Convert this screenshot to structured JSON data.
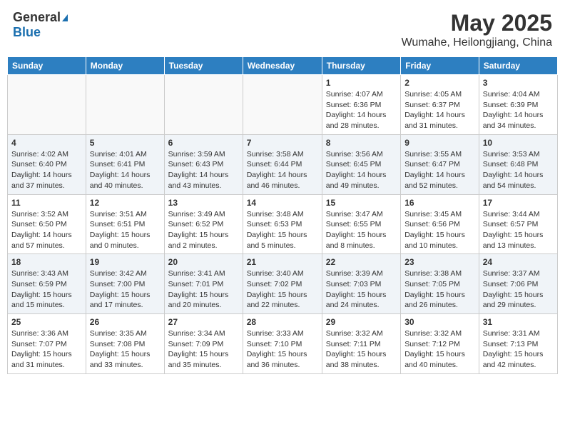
{
  "header": {
    "logo_general": "General",
    "logo_blue": "Blue",
    "title": "May 2025",
    "location": "Wumahe, Heilongjiang, China"
  },
  "days_of_week": [
    "Sunday",
    "Monday",
    "Tuesday",
    "Wednesday",
    "Thursday",
    "Friday",
    "Saturday"
  ],
  "weeks": [
    {
      "shaded": false,
      "days": [
        {
          "num": "",
          "info": ""
        },
        {
          "num": "",
          "info": ""
        },
        {
          "num": "",
          "info": ""
        },
        {
          "num": "",
          "info": ""
        },
        {
          "num": "1",
          "info": "Sunrise: 4:07 AM\nSunset: 6:36 PM\nDaylight: 14 hours\nand 28 minutes."
        },
        {
          "num": "2",
          "info": "Sunrise: 4:05 AM\nSunset: 6:37 PM\nDaylight: 14 hours\nand 31 minutes."
        },
        {
          "num": "3",
          "info": "Sunrise: 4:04 AM\nSunset: 6:39 PM\nDaylight: 14 hours\nand 34 minutes."
        }
      ]
    },
    {
      "shaded": true,
      "days": [
        {
          "num": "4",
          "info": "Sunrise: 4:02 AM\nSunset: 6:40 PM\nDaylight: 14 hours\nand 37 minutes."
        },
        {
          "num": "5",
          "info": "Sunrise: 4:01 AM\nSunset: 6:41 PM\nDaylight: 14 hours\nand 40 minutes."
        },
        {
          "num": "6",
          "info": "Sunrise: 3:59 AM\nSunset: 6:43 PM\nDaylight: 14 hours\nand 43 minutes."
        },
        {
          "num": "7",
          "info": "Sunrise: 3:58 AM\nSunset: 6:44 PM\nDaylight: 14 hours\nand 46 minutes."
        },
        {
          "num": "8",
          "info": "Sunrise: 3:56 AM\nSunset: 6:45 PM\nDaylight: 14 hours\nand 49 minutes."
        },
        {
          "num": "9",
          "info": "Sunrise: 3:55 AM\nSunset: 6:47 PM\nDaylight: 14 hours\nand 52 minutes."
        },
        {
          "num": "10",
          "info": "Sunrise: 3:53 AM\nSunset: 6:48 PM\nDaylight: 14 hours\nand 54 minutes."
        }
      ]
    },
    {
      "shaded": false,
      "days": [
        {
          "num": "11",
          "info": "Sunrise: 3:52 AM\nSunset: 6:50 PM\nDaylight: 14 hours\nand 57 minutes."
        },
        {
          "num": "12",
          "info": "Sunrise: 3:51 AM\nSunset: 6:51 PM\nDaylight: 15 hours\nand 0 minutes."
        },
        {
          "num": "13",
          "info": "Sunrise: 3:49 AM\nSunset: 6:52 PM\nDaylight: 15 hours\nand 2 minutes."
        },
        {
          "num": "14",
          "info": "Sunrise: 3:48 AM\nSunset: 6:53 PM\nDaylight: 15 hours\nand 5 minutes."
        },
        {
          "num": "15",
          "info": "Sunrise: 3:47 AM\nSunset: 6:55 PM\nDaylight: 15 hours\nand 8 minutes."
        },
        {
          "num": "16",
          "info": "Sunrise: 3:45 AM\nSunset: 6:56 PM\nDaylight: 15 hours\nand 10 minutes."
        },
        {
          "num": "17",
          "info": "Sunrise: 3:44 AM\nSunset: 6:57 PM\nDaylight: 15 hours\nand 13 minutes."
        }
      ]
    },
    {
      "shaded": true,
      "days": [
        {
          "num": "18",
          "info": "Sunrise: 3:43 AM\nSunset: 6:59 PM\nDaylight: 15 hours\nand 15 minutes."
        },
        {
          "num": "19",
          "info": "Sunrise: 3:42 AM\nSunset: 7:00 PM\nDaylight: 15 hours\nand 17 minutes."
        },
        {
          "num": "20",
          "info": "Sunrise: 3:41 AM\nSunset: 7:01 PM\nDaylight: 15 hours\nand 20 minutes."
        },
        {
          "num": "21",
          "info": "Sunrise: 3:40 AM\nSunset: 7:02 PM\nDaylight: 15 hours\nand 22 minutes."
        },
        {
          "num": "22",
          "info": "Sunrise: 3:39 AM\nSunset: 7:03 PM\nDaylight: 15 hours\nand 24 minutes."
        },
        {
          "num": "23",
          "info": "Sunrise: 3:38 AM\nSunset: 7:05 PM\nDaylight: 15 hours\nand 26 minutes."
        },
        {
          "num": "24",
          "info": "Sunrise: 3:37 AM\nSunset: 7:06 PM\nDaylight: 15 hours\nand 29 minutes."
        }
      ]
    },
    {
      "shaded": false,
      "days": [
        {
          "num": "25",
          "info": "Sunrise: 3:36 AM\nSunset: 7:07 PM\nDaylight: 15 hours\nand 31 minutes."
        },
        {
          "num": "26",
          "info": "Sunrise: 3:35 AM\nSunset: 7:08 PM\nDaylight: 15 hours\nand 33 minutes."
        },
        {
          "num": "27",
          "info": "Sunrise: 3:34 AM\nSunset: 7:09 PM\nDaylight: 15 hours\nand 35 minutes."
        },
        {
          "num": "28",
          "info": "Sunrise: 3:33 AM\nSunset: 7:10 PM\nDaylight: 15 hours\nand 36 minutes."
        },
        {
          "num": "29",
          "info": "Sunrise: 3:32 AM\nSunset: 7:11 PM\nDaylight: 15 hours\nand 38 minutes."
        },
        {
          "num": "30",
          "info": "Sunrise: 3:32 AM\nSunset: 7:12 PM\nDaylight: 15 hours\nand 40 minutes."
        },
        {
          "num": "31",
          "info": "Sunrise: 3:31 AM\nSunset: 7:13 PM\nDaylight: 15 hours\nand 42 minutes."
        }
      ]
    }
  ]
}
